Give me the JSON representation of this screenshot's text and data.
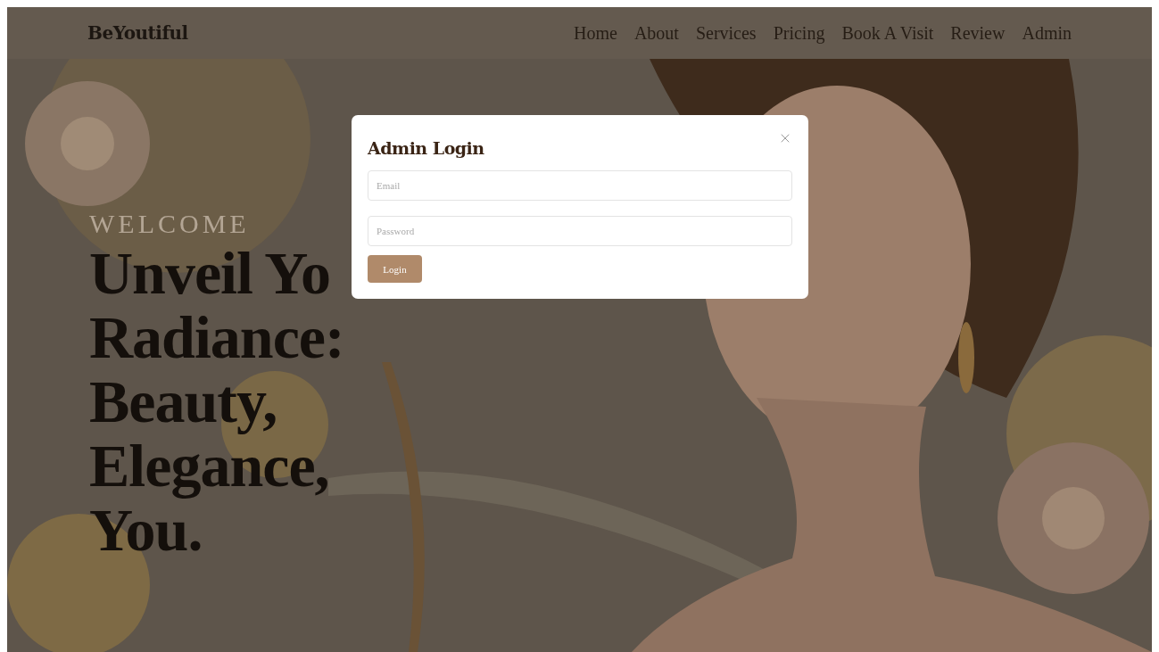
{
  "brand": "BeYoutiful",
  "nav": [
    "Home",
    "About",
    "Services",
    "Pricing",
    "Book A Visit",
    "Review",
    "Admin"
  ],
  "hero": {
    "eyebrow": "WELCOME",
    "headline_lines": [
      "Unveil Yo",
      "Radiance:",
      "Beauty,",
      "Elegance,",
      "You."
    ]
  },
  "modal": {
    "title": "Admin Login",
    "fields": [
      {
        "placeholder": "Email"
      },
      {
        "placeholder": "Password"
      }
    ],
    "submit": "Login"
  }
}
